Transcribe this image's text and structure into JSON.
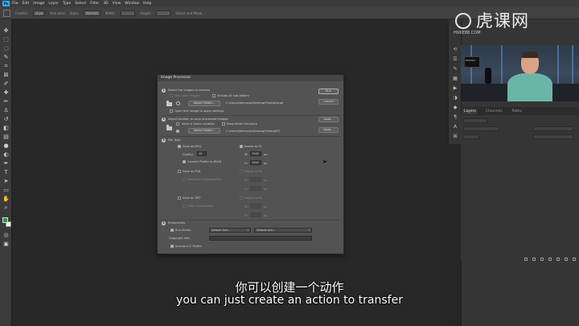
{
  "menubar": {
    "logo": "Ps",
    "items": [
      "File",
      "Edit",
      "Image",
      "Layer",
      "Type",
      "Select",
      "Filter",
      "3D",
      "View",
      "Window",
      "Help"
    ]
  },
  "optionsbar": {
    "feather_label": "Feather:",
    "feather_value": "0 px",
    "antialias_label": "Anti-alias",
    "style_label": "Style:",
    "style_value": "Normal",
    "width_label": "Width:",
    "height_label": "Height:",
    "select_mask_label": "Select and Mask..."
  },
  "watermark": {
    "brand": "虎课网",
    "sub": "HUKE88.COM"
  },
  "video": {
    "screen_text": "DESIGN"
  },
  "panels": {
    "tabs": [
      "Layers",
      "Channels",
      "Paths"
    ],
    "active_tab": "Layers"
  },
  "dialog": {
    "title": "Image Processor",
    "step1": {
      "num": "1",
      "heading": "Select the images to process",
      "use_open_images": "Use Open Images",
      "include_subfolders": "Include All sub-folders",
      "select_folder": "Select Folder...",
      "path": "C:\\Users\\Nemanja\\Desktop\\Photo\\Large",
      "open_first": "Open first image to apply settings"
    },
    "step2": {
      "num": "2",
      "heading": "Select location to save processed images",
      "same_location": "Save in Same Location",
      "keep_structure": "Keep folder structure",
      "select_folder": "Select Folder...",
      "path": "C:\\Users\\Nemanja\\Desktop\\Photo\\JPG"
    },
    "step3": {
      "num": "3",
      "heading": "File Type",
      "save_jpeg": "Save as JPEG",
      "resize_to_fit_1": "Resize to Fit",
      "quality_label": "Quality:",
      "quality_value": "10",
      "w_label": "W:",
      "w_value": "2048",
      "h_label": "H:",
      "h_value": "2048",
      "unit": "px",
      "convert_srgb": "Convert Profile to sRGB",
      "save_psd": "Save as PSD",
      "resize_to_fit_2": "Resize to Fit",
      "maximize_compat": "Maximize Compatibility",
      "save_tiff": "Save as TIFF",
      "resize_to_fit_3": "Resize to Fit",
      "lzw": "LZW Compression"
    },
    "step4": {
      "num": "4",
      "heading": "Preferences",
      "run_action": "Run Action:",
      "action_set": "Default Acti...",
      "action_name": "Default Acti...",
      "copyright_label": "Copyright Info:",
      "include_icc": "Include ICC Profile"
    },
    "buttons": {
      "run": "Run",
      "cancel": "Cancel",
      "load": "Load...",
      "save": "Save..."
    }
  },
  "subtitles": {
    "chinese": "你可以创建一个动作",
    "english": "you can just create an action to transfer"
  }
}
